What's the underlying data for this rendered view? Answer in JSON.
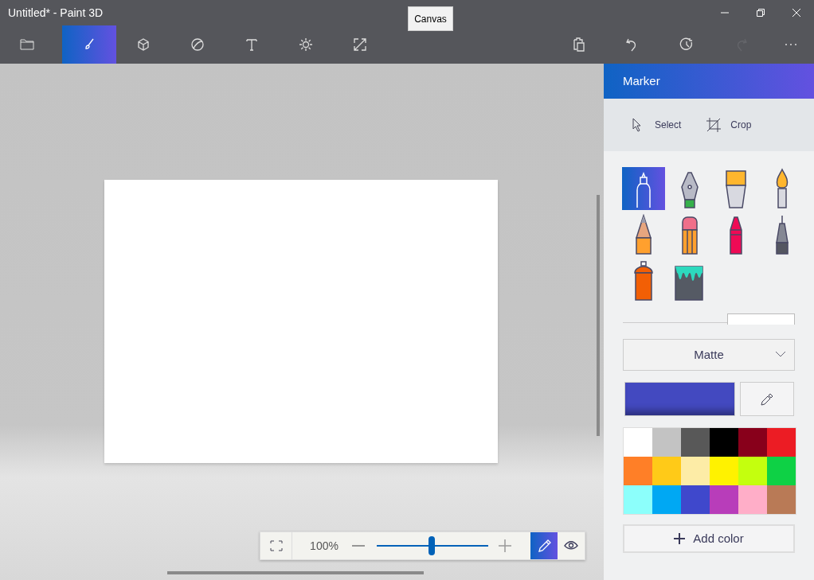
{
  "window": {
    "title": "Untitled* - Paint 3D"
  },
  "tooltip": {
    "text": "Canvas"
  },
  "tabs": [
    {
      "selected": true
    },
    {
      "selected": false
    },
    {
      "selected": false
    },
    {
      "selected": false
    },
    {
      "selected": false
    },
    {
      "selected": false
    }
  ],
  "actions": [
    {
      "disabled": false
    },
    {
      "disabled": false
    },
    {
      "disabled": false
    },
    {
      "disabled": true
    },
    {
      "disabled": false
    }
  ],
  "panel": {
    "title": "Marker",
    "commands": [
      {
        "label": "Select"
      },
      {
        "label": "Crop"
      }
    ],
    "tools": [
      {
        "selected": true
      },
      {
        "selected": false
      },
      {
        "selected": false
      },
      {
        "selected": false
      },
      {
        "selected": false
      },
      {
        "selected": false
      },
      {
        "selected": false
      },
      {
        "selected": false
      },
      {
        "selected": false
      },
      {
        "selected": false
      }
    ],
    "finish": {
      "value": "Matte"
    },
    "current": {
      "color": "#4349c0"
    },
    "palette": [
      {
        "color": "#ffffff"
      },
      {
        "color": "#c3c3c3"
      },
      {
        "color": "#585858"
      },
      {
        "color": "#000000"
      },
      {
        "color": "#88001b"
      },
      {
        "color": "#ec1c24"
      },
      {
        "color": "#ff7f27"
      },
      {
        "color": "#ffca18"
      },
      {
        "color": "#fdeca6"
      },
      {
        "color": "#fff200"
      },
      {
        "color": "#c4ff0e"
      },
      {
        "color": "#0ed145"
      },
      {
        "color": "#8cfffb"
      },
      {
        "color": "#00a8f3"
      },
      {
        "color": "#3f48cc"
      },
      {
        "color": "#b83dba"
      },
      {
        "color": "#ffaec8"
      },
      {
        "color": "#b97a56"
      }
    ],
    "add_color": "Add color"
  },
  "zoom": {
    "reading": "100%",
    "level": 0.49,
    "modes": [
      {
        "selected": true
      },
      {
        "selected": false
      }
    ]
  }
}
